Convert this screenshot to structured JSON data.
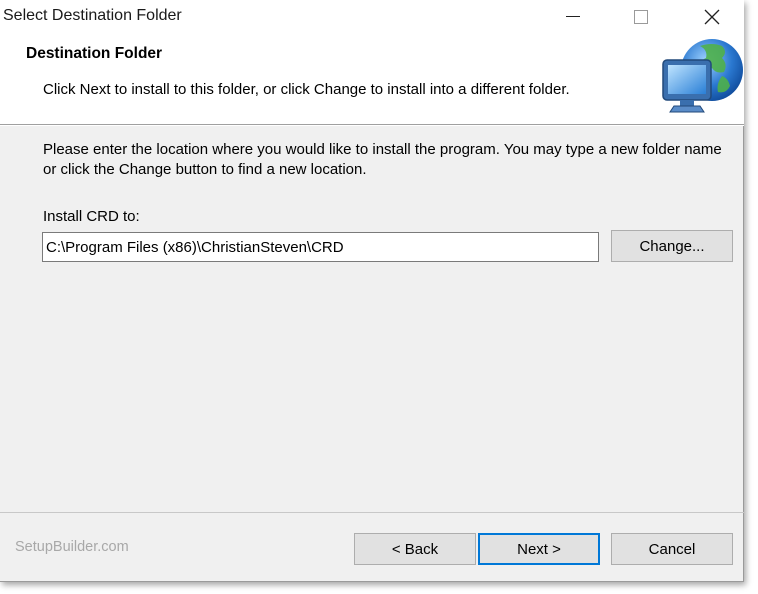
{
  "window": {
    "title": "Select Destination Folder"
  },
  "header": {
    "title": "Destination Folder",
    "subtitle": "Click Next to install to this folder, or click Change to install into a different folder.",
    "icon": "computer-globe-icon"
  },
  "content": {
    "description": "Please enter the location where you would like to install the program. You may type a new folder name or click the Change button to find a new location.",
    "install_label": "Install CRD to:",
    "install_path": "C:\\Program Files (x86)\\ChristianSteven\\CRD",
    "change_label": "Change..."
  },
  "footer": {
    "brand": "SetupBuilder.com",
    "back_label": "< Back",
    "next_label": "Next >",
    "cancel_label": "Cancel"
  },
  "colors": {
    "focus_border": "#0078d7",
    "dialog_bg": "#f0f0f0",
    "button_bg": "#e1e1e1"
  }
}
